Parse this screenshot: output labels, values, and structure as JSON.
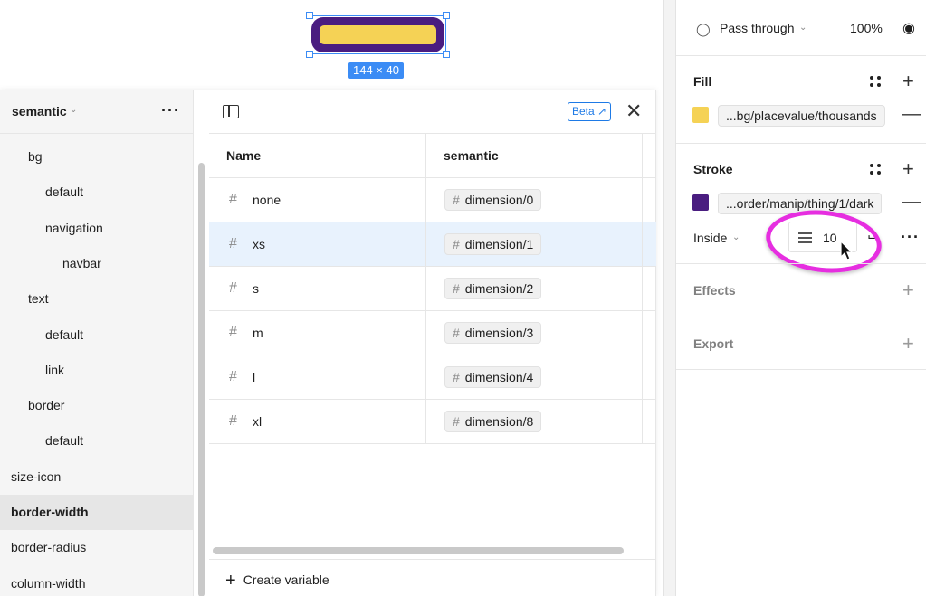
{
  "canvas": {
    "dimension_label": "144 × 40",
    "colors": {
      "shape_fill": "#4a1d80",
      "inner_fill": "#f5d255",
      "selection": "#3b8cf5"
    }
  },
  "variables_modal": {
    "collection_name": "semantic",
    "groups": [
      {
        "label": "bg",
        "level": 1
      },
      {
        "label": "default",
        "level": 2
      },
      {
        "label": "navigation",
        "level": 2
      },
      {
        "label": "navbar",
        "level": 3
      },
      {
        "label": "text",
        "level": 1
      },
      {
        "label": "default",
        "level": 2
      },
      {
        "label": "link",
        "level": 2
      },
      {
        "label": "border",
        "level": 1
      },
      {
        "label": "default",
        "level": 2
      },
      {
        "label": "size-icon",
        "level": 0
      },
      {
        "label": "border-width",
        "level": 0,
        "selected": true
      },
      {
        "label": "border-radius",
        "level": 0
      },
      {
        "label": "column-width",
        "level": 0
      }
    ],
    "beta_label": "Beta",
    "columns": {
      "name": "Name",
      "mode": "semantic"
    },
    "rows": [
      {
        "name": "none",
        "value": "dimension/0"
      },
      {
        "name": "xs",
        "value": "dimension/1",
        "highlighted": true
      },
      {
        "name": "s",
        "value": "dimension/2"
      },
      {
        "name": "m",
        "value": "dimension/3"
      },
      {
        "name": "l",
        "value": "dimension/4"
      },
      {
        "name": "xl",
        "value": "dimension/8"
      }
    ],
    "create_label": "Create variable"
  },
  "properties": {
    "layer": {
      "blend_mode": "Pass through",
      "opacity": "100%"
    },
    "fill": {
      "title": "Fill",
      "token": "...bg/placevalue/thousands",
      "color": "#f5d255"
    },
    "stroke": {
      "title": "Stroke",
      "token": "...order/manip/thing/1/dark",
      "color": "#4a1d80",
      "position": "Inside",
      "weight": "10"
    },
    "effects": {
      "title": "Effects"
    },
    "export": {
      "title": "Export"
    },
    "annotation_color": "#e62ee0"
  }
}
